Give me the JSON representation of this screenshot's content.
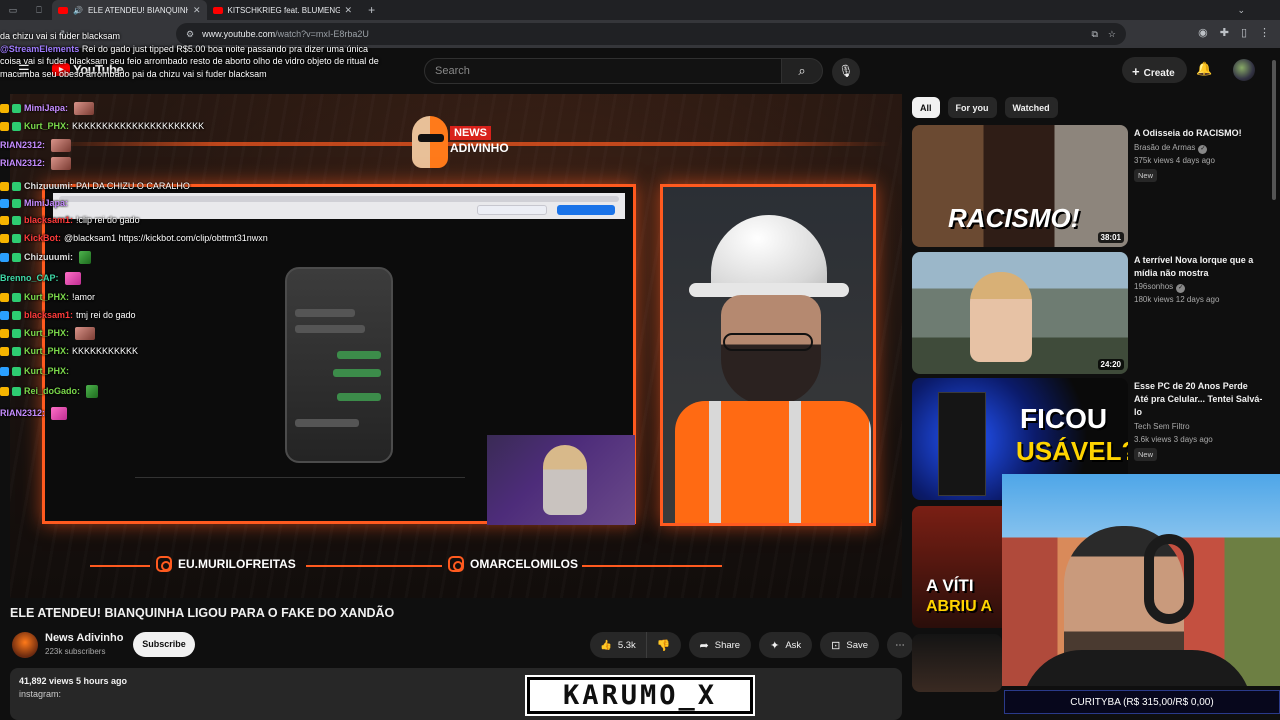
{
  "browser": {
    "tabs": [
      {
        "title": "ELE ATENDEU! BIANQUINHA",
        "active": true
      },
      {
        "title": "KITSCHKRIEG feat. BLUMENGA",
        "active": false
      }
    ],
    "url_host": "www.youtube.com",
    "url_path": "/watch?v=mxI-E8rba2U"
  },
  "youtube": {
    "logo_text": "YouTube",
    "search_placeholder": "Search",
    "create_label": "Create"
  },
  "chat": {
    "top_overlay": "da chizu vai si fuder blacksam",
    "tip_user": "@StreamElements",
    "tip_text": "Rei do gado just tipped R$5.00 boa noite passando pra dizer uma única coisa vai si fuder blacksam seu feio arrombado resto de aborto olho de vidro objeto de ritual de macumba seu obeso arrombado pai da chizu vai si fuder blacksam",
    "messages": [
      {
        "user": "MimiJapa",
        "text": "",
        "color": "#c58cff",
        "emote": "face"
      },
      {
        "user": "Kurt_PHX",
        "text": "KKKKKKKKKKKKKKKKKKKKKK",
        "color": "#7bd84b",
        "emote": ""
      },
      {
        "user": "RIAN2312",
        "text": "",
        "color": "#c58cff",
        "emote": "face"
      },
      {
        "user": "RIAN2312",
        "text": "",
        "color": "#c58cff",
        "emote": "face"
      },
      {
        "user": "Chizuuumi",
        "text": "PAI DA CHIZU O CARALHO",
        "color": "#dddddd",
        "emote": ""
      },
      {
        "user": "MimiJapa",
        "text": "",
        "color": "#c58cff",
        "emote": ""
      },
      {
        "user": "blacksam1",
        "text": "!clip rei do gado",
        "color": "#ff3b3b",
        "emote": ""
      },
      {
        "user": "KickBot",
        "text": "@blacksam1 https://kickbot.com/clip/obttmt31nwxn",
        "color": "#ff3b3b",
        "emote": ""
      },
      {
        "user": "Chizuuumi",
        "text": "",
        "color": "#dddddd",
        "emote": "green"
      },
      {
        "user": "Brenno_CAP",
        "text": "",
        "color": "#3fd9a8",
        "emote": "pink"
      },
      {
        "user": "Kurt_PHX",
        "text": "!amor",
        "color": "#7bd84b",
        "emote": ""
      },
      {
        "user": "blacksam1",
        "text": "tmj rei do gado",
        "color": "#ff3b3b",
        "emote": ""
      },
      {
        "user": "Kurt_PHX",
        "text": "",
        "color": "#7bd84b",
        "emote": "face"
      },
      {
        "user": "Kurt_PHX",
        "text": "KKKKKKKKKKK",
        "color": "#7bd84b",
        "emote": ""
      },
      {
        "user": "Kurt_PHX",
        "text": "",
        "color": "#7bd84b",
        "emote": ""
      },
      {
        "user": "Rei_doGado",
        "text": "",
        "color": "#7bd84b",
        "emote": "green"
      },
      {
        "user": "RIAN2312",
        "text": "",
        "color": "#c58cff",
        "emote": "pink"
      }
    ]
  },
  "player": {
    "logo_word1": "NEWS",
    "logo_word2": "ADIVINHO",
    "handle_left": "EU.MURILOFREITAS",
    "handle_right": "OMARCELOMILOS"
  },
  "video": {
    "title": "ELE ATENDEU! BIANQUINHA LIGOU PARA O FAKE DO XANDÃO",
    "channel": "News Adivinho",
    "subscribers": "223k subscribers",
    "subscribe_label": "Subscribe",
    "likes": "5.3k",
    "share_label": "Share",
    "ask_label": "Ask",
    "save_label": "Save",
    "views_time": "41,892 views  5 hours ago",
    "desc_snippet": "instagram:"
  },
  "sidebar": {
    "chips": [
      "All",
      "For you",
      "Watched"
    ],
    "recs": [
      {
        "title": "A Odisseia do RACISMO!",
        "channel": "Brasão de Armas",
        "meta": "375k views  4 days ago",
        "badge": "New",
        "duration": "38:01",
        "thumb_text": "RACISMO!"
      },
      {
        "title": "A terrível Nova Iorque que a mídia não mostra",
        "channel": "196sonhos",
        "meta": "180k views  12 days ago",
        "badge": "",
        "duration": "24:20",
        "thumb_text": ""
      },
      {
        "title": "Esse PC de 20 Anos Perde Até pra Celular... Tentei Salvá-lo",
        "channel": "Tech Sem Filtro",
        "meta": "3.6k views  3 days ago",
        "badge": "New",
        "duration": "",
        "thumb_text": "FICOU",
        "thumb_text2": "USÁVEL?"
      },
      {
        "title": "",
        "channel": "",
        "meta": "",
        "badge": "",
        "duration": "",
        "thumb_text": "A VÍTI",
        "thumb_text2": "ABRIU A"
      }
    ]
  },
  "overlay": {
    "streamer_name": "KARUMO_X",
    "ticker": "CURITYBA (R$ 315,00/R$ 0,00)"
  }
}
